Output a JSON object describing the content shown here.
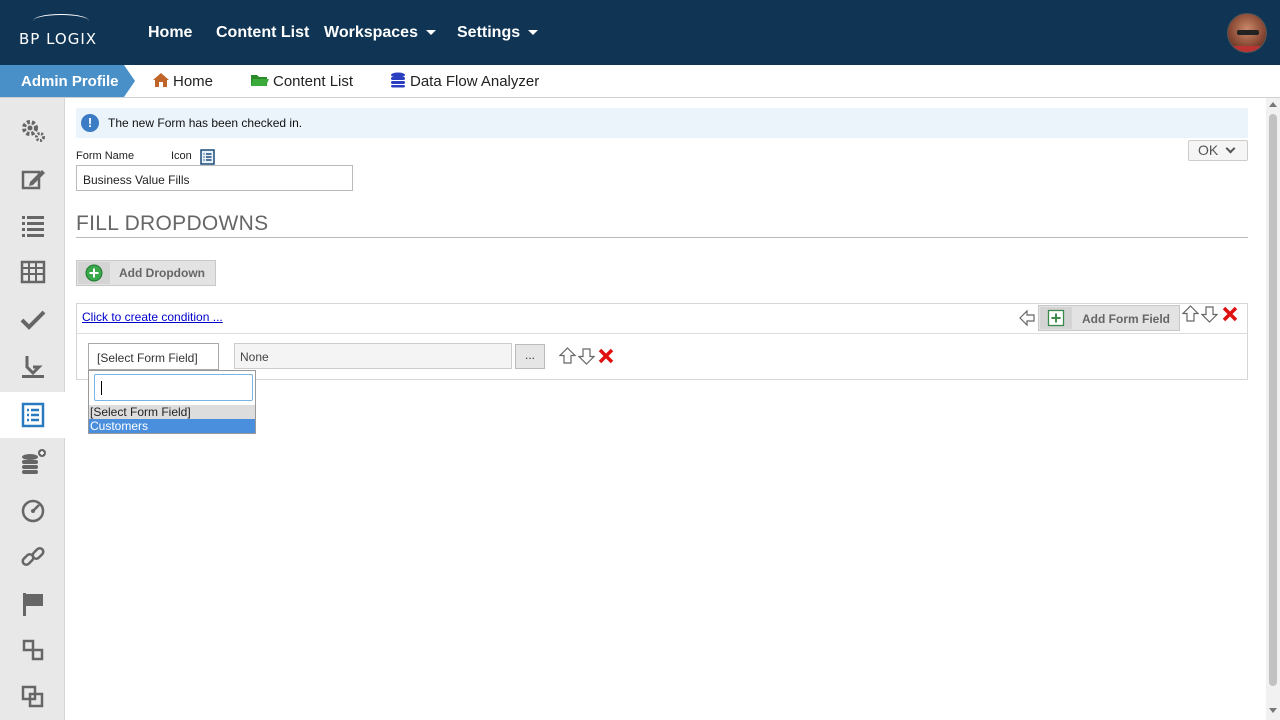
{
  "topbar": {
    "logo": "BP LOGIX",
    "nav": [
      {
        "label": "Home"
      },
      {
        "label": "Content List"
      },
      {
        "label": "Workspaces"
      },
      {
        "label": "Settings"
      }
    ],
    "colors": {
      "bg": "#0f3454"
    }
  },
  "breadcrumb": {
    "profile": "Admin Profile",
    "items": [
      {
        "label": "Home",
        "icon": "home-icon"
      },
      {
        "label": "Content List",
        "icon": "folder-icon"
      },
      {
        "label": "Data Flow Analyzer",
        "icon": "database-icon"
      }
    ]
  },
  "sidebar": {
    "items": [
      {
        "icon": "gears-icon"
      },
      {
        "icon": "edit-icon"
      },
      {
        "icon": "list-icon"
      },
      {
        "icon": "table-icon"
      },
      {
        "icon": "checkmark-icon"
      },
      {
        "icon": "download-tray-icon"
      },
      {
        "icon": "form-icon",
        "active": true
      },
      {
        "icon": "database-add-icon"
      },
      {
        "icon": "dashboard-icon"
      },
      {
        "icon": "link-icon"
      },
      {
        "icon": "flag-icon"
      },
      {
        "icon": "hierarchy-icon"
      },
      {
        "icon": "copy-icon"
      }
    ]
  },
  "alert": {
    "message": "The new Form has been checked in."
  },
  "ok_button": "OK",
  "form": {
    "name_label": "Form Name",
    "icon_label": "Icon",
    "name_value": "Business Value Fills"
  },
  "section": {
    "title": "FILL DROPDOWNS",
    "add_dropdown_label": "Add Dropdown"
  },
  "condition": {
    "link_text": "Click to create condition ...",
    "add_form_field_label": "Add Form Field"
  },
  "row": {
    "select_field": "[Select Form Field]",
    "value_field": "None",
    "dots_button": "..."
  },
  "dropdown": {
    "search_value": "",
    "options": [
      {
        "label": "[Select Form Field]",
        "state": "selected"
      },
      {
        "label": "Customers",
        "state": "highlighted"
      }
    ]
  }
}
